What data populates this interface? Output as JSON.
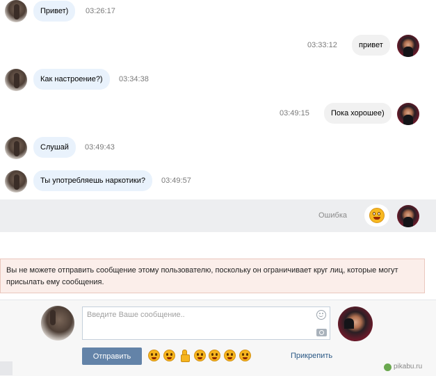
{
  "messages": [
    {
      "side": "in",
      "text": "Привет)",
      "time": "03:26:17"
    },
    {
      "side": "out",
      "text": "привет",
      "time": "03:33:12"
    },
    {
      "side": "in",
      "text": "Как настроение?)",
      "time": "03:34:38"
    },
    {
      "side": "out",
      "text": "Пока хорошее)",
      "time": "03:49:15"
    },
    {
      "side": "in",
      "text": "Слушай",
      "time": "03:49:43"
    },
    {
      "side": "in",
      "text": "Ты употребляешь наркотики?",
      "time": "03:49:57"
    }
  ],
  "failed_message": {
    "status": "Ошибка",
    "content_icon": "smiley-emoji-icon"
  },
  "notice": {
    "text": "Вы не можете отправить сообщение этому пользователю, поскольку он ограничивает круг лиц, которые могут присылать ему сообщения."
  },
  "composer": {
    "placeholder": "Введите Ваше сообщение..",
    "send_label": "Отправить",
    "attach_label": "Прикрепить",
    "emoji_icons": [
      "grin-emoji-icon",
      "surprised-emoji-icon",
      "thumbs-up-emoji-icon",
      "laugh-emoji-icon",
      "smirk-emoji-icon",
      "worried-emoji-icon",
      "neutral-emoji-icon"
    ]
  },
  "watermark": {
    "text": "pikabu.ru"
  },
  "colors": {
    "incoming_bubble": "#e9f2fc",
    "outgoing_bubble": "#f1f1f1",
    "send_button": "#6383a8",
    "link": "#2a5885",
    "notice_bg": "#fbeeea"
  }
}
